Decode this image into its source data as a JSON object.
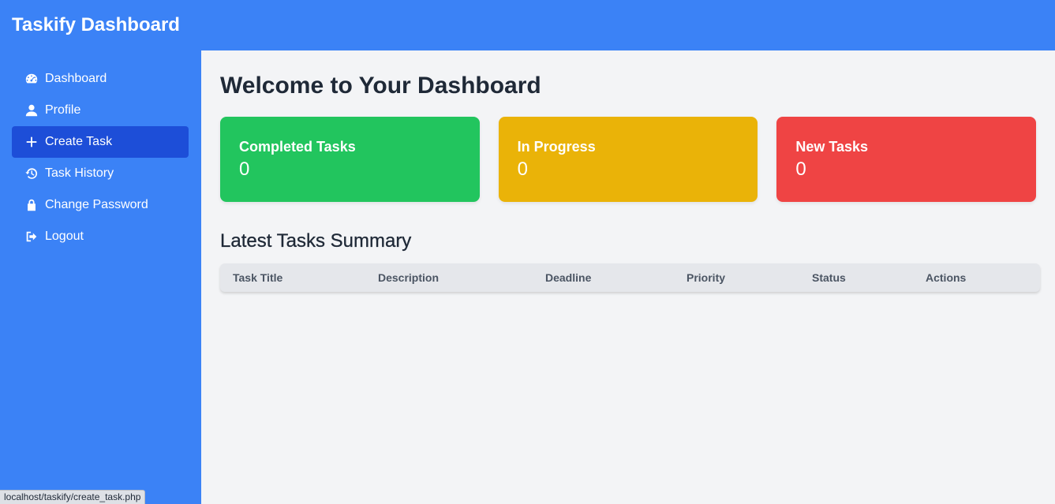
{
  "header": {
    "title": "Taskify Dashboard"
  },
  "sidebar": {
    "items": [
      {
        "label": "Dashboard",
        "icon": "dashboard-icon"
      },
      {
        "label": "Profile",
        "icon": "user-icon"
      },
      {
        "label": "Create Task",
        "icon": "plus-icon",
        "active": true
      },
      {
        "label": "Task History",
        "icon": "history-icon"
      },
      {
        "label": "Change Password",
        "icon": "lock-icon"
      },
      {
        "label": "Logout",
        "icon": "logout-icon"
      }
    ]
  },
  "main": {
    "title": "Welcome to Your Dashboard",
    "cards": [
      {
        "label": "Completed Tasks",
        "value": "0",
        "color": "#22c55e"
      },
      {
        "label": "In Progress",
        "value": "0",
        "color": "#eab308"
      },
      {
        "label": "New Tasks",
        "value": "0",
        "color": "#ef4444"
      }
    ],
    "summary_title": "Latest Tasks Summary",
    "table": {
      "columns": [
        "Task Title",
        "Description",
        "Deadline",
        "Priority",
        "Status",
        "Actions"
      ]
    }
  },
  "status_bar": {
    "url": "localhost/taskify/create_task.php"
  },
  "colors": {
    "primary": "#3b82f6",
    "active": "#1d4ed8",
    "background": "#f3f4f6"
  }
}
